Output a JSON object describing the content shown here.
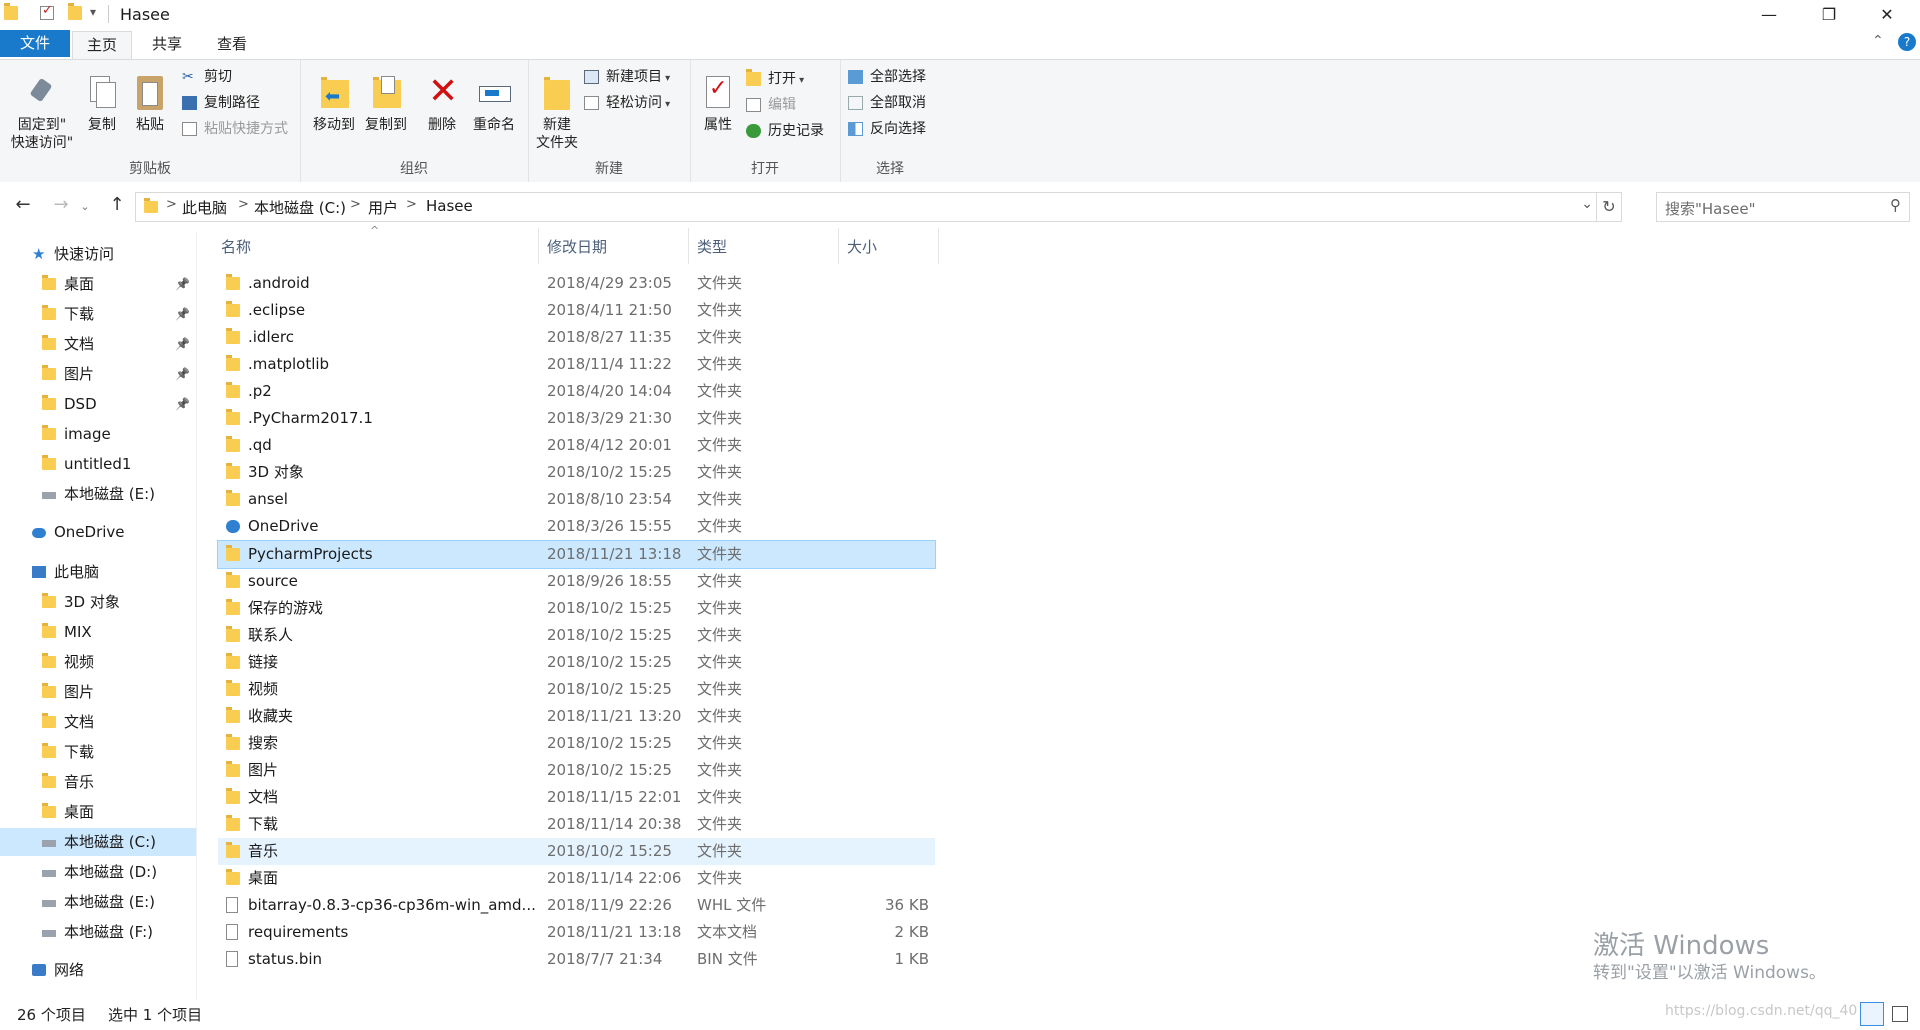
{
  "window": {
    "title": "Hasee",
    "controls": {
      "minimize": "—",
      "restore": "❐",
      "close": "✕"
    },
    "qat_dropdown": "▾"
  },
  "ribbon_tabs": [
    "文件",
    "主页",
    "共享",
    "查看"
  ],
  "ribbon": {
    "clipboard": {
      "label": "剪贴板",
      "pin_quick": "固定到\"\n快速访问\"",
      "copy": "复制",
      "paste": "粘贴",
      "cut": "剪切",
      "copy_path": "复制路径",
      "paste_shortcut": "粘贴快捷方式"
    },
    "organize": {
      "label": "组织",
      "move_to": "移动到",
      "copy_to": "复制到",
      "delete": "删除",
      "rename": "重命名"
    },
    "new": {
      "label": "新建",
      "new_folder": "新建\n文件夹",
      "new_item": "新建项目",
      "easy_access": "轻松访问"
    },
    "open": {
      "label": "打开",
      "properties": "属性",
      "open": "打开",
      "edit": "编辑",
      "history": "历史记录"
    },
    "select": {
      "label": "选择",
      "select_all": "全部选择",
      "select_none": "全部取消",
      "invert": "反向选择"
    }
  },
  "address": {
    "back": "←",
    "forward": "→",
    "up": "↑",
    "crumbs": [
      "此电脑",
      "本地磁盘 (C:)",
      "用户",
      "Hasee"
    ],
    "separator": ">",
    "dropdown": "⌄",
    "refresh": "↻",
    "search_placeholder": "搜索\"Hasee\"",
    "search_icon": "⚲"
  },
  "nav_pane": [
    {
      "label": "快速访问",
      "icon": "star-icon",
      "level": 0,
      "pinned": false
    },
    {
      "label": "桌面",
      "icon": "desktop-folder-icon",
      "level": 1,
      "pinned": true
    },
    {
      "label": "下载",
      "icon": "download-folder-icon",
      "level": 1,
      "pinned": true
    },
    {
      "label": "文档",
      "icon": "documents-folder-icon",
      "level": 1,
      "pinned": true
    },
    {
      "label": "图片",
      "icon": "pictures-folder-icon",
      "level": 1,
      "pinned": true
    },
    {
      "label": "DSD",
      "icon": "folder-icon",
      "level": 1,
      "pinned": true
    },
    {
      "label": "image",
      "icon": "folder-icon",
      "level": 1,
      "pinned": false
    },
    {
      "label": "untitled1",
      "icon": "folder-icon",
      "level": 1,
      "pinned": false
    },
    {
      "label": "本地磁盘 (E:)",
      "icon": "drive-icon",
      "level": 1,
      "pinned": false
    },
    {
      "label": "OneDrive",
      "icon": "cloud-icon",
      "level": 0,
      "pinned": false
    },
    {
      "label": "此电脑",
      "icon": "computer-icon",
      "level": 0,
      "pinned": false
    },
    {
      "label": "3D 对象",
      "icon": "3d-objects-icon",
      "level": 1,
      "pinned": false
    },
    {
      "label": "MIX",
      "icon": "device-icon",
      "level": 1,
      "pinned": false
    },
    {
      "label": "视频",
      "icon": "videos-folder-icon",
      "level": 1,
      "pinned": false
    },
    {
      "label": "图片",
      "icon": "pictures-folder-icon",
      "level": 1,
      "pinned": false
    },
    {
      "label": "文档",
      "icon": "documents-folder-icon",
      "level": 1,
      "pinned": false
    },
    {
      "label": "下载",
      "icon": "download-folder-icon",
      "level": 1,
      "pinned": false
    },
    {
      "label": "音乐",
      "icon": "music-folder-icon",
      "level": 1,
      "pinned": false
    },
    {
      "label": "桌面",
      "icon": "desktop-folder-icon",
      "level": 1,
      "pinned": false
    },
    {
      "label": "本地磁盘 (C:)",
      "icon": "system-drive-icon",
      "level": 1,
      "pinned": false,
      "selected": true
    },
    {
      "label": "本地磁盘 (D:)",
      "icon": "drive-icon",
      "level": 1,
      "pinned": false
    },
    {
      "label": "本地磁盘 (E:)",
      "icon": "drive-icon",
      "level": 1,
      "pinned": false
    },
    {
      "label": "本地磁盘 (F:)",
      "icon": "drive-icon",
      "level": 1,
      "pinned": false
    },
    {
      "label": "网络",
      "icon": "network-icon",
      "level": 0,
      "pinned": false
    }
  ],
  "columns": {
    "name": "名称",
    "modified": "修改日期",
    "type": "类型",
    "size": "大小",
    "sort_indicator": "^"
  },
  "files": [
    {
      "name": ".android",
      "modified": "2018/4/29 23:05",
      "type": "文件夹",
      "size": "",
      "icon": "folder-icon"
    },
    {
      "name": ".eclipse",
      "modified": "2018/4/11 21:50",
      "type": "文件夹",
      "size": "",
      "icon": "folder-icon"
    },
    {
      "name": ".idlerc",
      "modified": "2018/8/27 11:35",
      "type": "文件夹",
      "size": "",
      "icon": "folder-icon"
    },
    {
      "name": ".matplotlib",
      "modified": "2018/11/4 11:22",
      "type": "文件夹",
      "size": "",
      "icon": "folder-icon"
    },
    {
      "name": ".p2",
      "modified": "2018/4/20 14:04",
      "type": "文件夹",
      "size": "",
      "icon": "folder-icon"
    },
    {
      "name": ".PyCharm2017.1",
      "modified": "2018/3/29 21:30",
      "type": "文件夹",
      "size": "",
      "icon": "folder-icon"
    },
    {
      "name": ".qd",
      "modified": "2018/4/12 20:01",
      "type": "文件夹",
      "size": "",
      "icon": "folder-icon"
    },
    {
      "name": "3D 对象",
      "modified": "2018/10/2 15:25",
      "type": "文件夹",
      "size": "",
      "icon": "3d-objects-icon"
    },
    {
      "name": "ansel",
      "modified": "2018/8/10 23:54",
      "type": "文件夹",
      "size": "",
      "icon": "folder-icon"
    },
    {
      "name": "OneDrive",
      "modified": "2018/3/26 15:55",
      "type": "文件夹",
      "size": "",
      "icon": "cloud-icon"
    },
    {
      "name": "PycharmProjects",
      "modified": "2018/11/21 13:18",
      "type": "文件夹",
      "size": "",
      "icon": "folder-icon",
      "selected": true
    },
    {
      "name": "source",
      "modified": "2018/9/26 18:55",
      "type": "文件夹",
      "size": "",
      "icon": "folder-icon"
    },
    {
      "name": "保存的游戏",
      "modified": "2018/10/2 15:25",
      "type": "文件夹",
      "size": "",
      "icon": "saved-games-icon"
    },
    {
      "name": "联系人",
      "modified": "2018/10/2 15:25",
      "type": "文件夹",
      "size": "",
      "icon": "contacts-icon"
    },
    {
      "name": "链接",
      "modified": "2018/10/2 15:25",
      "type": "文件夹",
      "size": "",
      "icon": "links-icon"
    },
    {
      "name": "视频",
      "modified": "2018/10/2 15:25",
      "type": "文件夹",
      "size": "",
      "icon": "videos-folder-icon"
    },
    {
      "name": "收藏夹",
      "modified": "2018/11/21 13:20",
      "type": "文件夹",
      "size": "",
      "icon": "favorites-icon"
    },
    {
      "name": "搜索",
      "modified": "2018/10/2 15:25",
      "type": "文件夹",
      "size": "",
      "icon": "searches-icon"
    },
    {
      "name": "图片",
      "modified": "2018/10/2 15:25",
      "type": "文件夹",
      "size": "",
      "icon": "pictures-folder-icon"
    },
    {
      "name": "文档",
      "modified": "2018/11/15 22:01",
      "type": "文件夹",
      "size": "",
      "icon": "documents-folder-icon"
    },
    {
      "name": "下载",
      "modified": "2018/11/14 20:38",
      "type": "文件夹",
      "size": "",
      "icon": "download-folder-icon"
    },
    {
      "name": "音乐",
      "modified": "2018/10/2 15:25",
      "type": "文件夹",
      "size": "",
      "icon": "music-folder-icon",
      "hover": true
    },
    {
      "name": "桌面",
      "modified": "2018/11/14 22:06",
      "type": "文件夹",
      "size": "",
      "icon": "desktop-folder-icon"
    },
    {
      "name": "bitarray-0.8.3-cp36-cp36m-win_amd...",
      "modified": "2018/11/9 22:26",
      "type": "WHL 文件",
      "size": "36 KB",
      "icon": "file-icon"
    },
    {
      "name": "requirements",
      "modified": "2018/11/21 13:18",
      "type": "文本文档",
      "size": "2 KB",
      "icon": "text-file-icon"
    },
    {
      "name": "status.bin",
      "modified": "2018/7/7 21:34",
      "type": "BIN 文件",
      "size": "1 KB",
      "icon": "file-icon"
    }
  ],
  "status_bar": {
    "count": "26 个项目",
    "selected": "选中 1 个项目"
  },
  "watermark": {
    "line1": "激活 Windows",
    "line2": "转到\"设置\"以激活 Windows。",
    "blog": "https://blog.csdn.net/qq_40"
  },
  "colors": {
    "file_tab": "#1979ca",
    "selection": "#cce8ff",
    "folder": "#f8cd52",
    "header_text": "#4c607a"
  }
}
